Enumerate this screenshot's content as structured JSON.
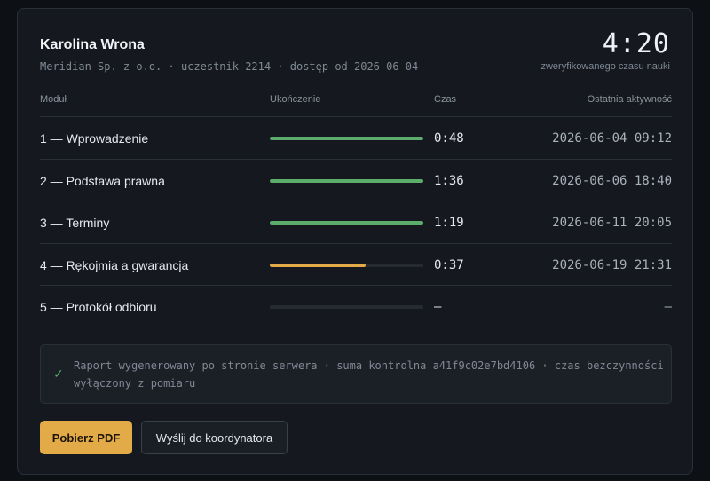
{
  "participant": {
    "name": "Karolina Wrona",
    "meta": "Meridian Sp. z o.o. · uczestnik 2214 · dostęp od 2026-06-04"
  },
  "total": {
    "time": "4:20",
    "label": "zweryfikowanego czasu nauki"
  },
  "table": {
    "headers": {
      "module": "Moduł",
      "progress": "Ukończenie",
      "time": "Czas",
      "last": "Ostatnia aktywność"
    },
    "rows": [
      {
        "module": "1 — Wprowadzenie",
        "progress": 1.0,
        "time": "0:48",
        "last": "2026-06-04 09:12"
      },
      {
        "module": "2 — Podstawa prawna",
        "progress": 1.0,
        "time": "1:36",
        "last": "2026-06-06 18:40"
      },
      {
        "module": "3 — Terminy",
        "progress": 1.0,
        "time": "1:19",
        "last": "2026-06-11 20:05"
      },
      {
        "module": "4 — Rękojmia a gwarancja",
        "progress": 0.625,
        "time": "0:37",
        "last": "2026-06-19 21:31"
      },
      {
        "module": "5 — Protokół odbioru",
        "progress": 0,
        "time": "—",
        "last": "—"
      }
    ]
  },
  "notice": {
    "icon": "check-icon",
    "text": "Raport wygenerowany po stronie serwera · suma kontrolna a41f9c02e7bd4106 · czas bezczynności wyłączony z pomiaru"
  },
  "buttons": {
    "download": "Pobierz PDF",
    "send": "Wyślij do koordynatora"
  },
  "colors": {
    "complete": "#5cad6c",
    "partial": "#e2ab47",
    "track": "#262b33",
    "accent": "#e2ab47"
  }
}
